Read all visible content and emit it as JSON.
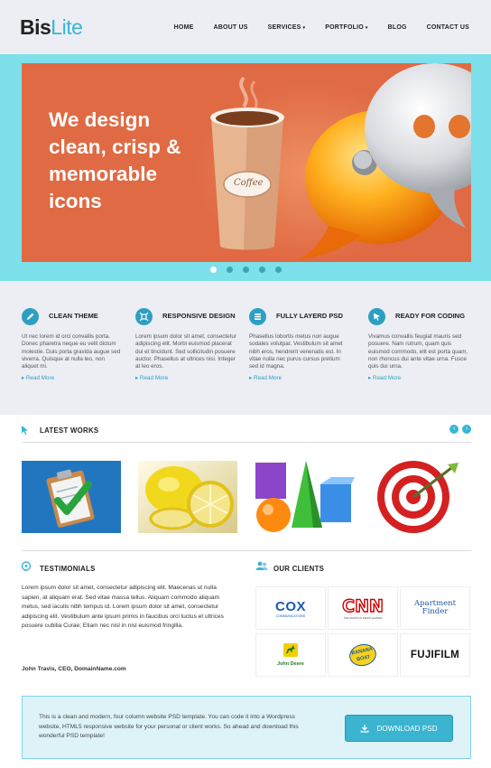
{
  "brand": {
    "name_bold": "Bis",
    "name_light": "Lite"
  },
  "nav": {
    "items": [
      "HOME",
      "ABOUT US",
      "SERVICES",
      "PORTFOLIO",
      "BLOG",
      "CONTACT US"
    ],
    "caret": "▾"
  },
  "hero": {
    "headline": "We design clean, crisp & memorable icons",
    "cup_label": "Coffee",
    "active_slide": 1,
    "slide_count": 5
  },
  "features": [
    {
      "title": "CLEAN THEME",
      "text": "Ut nec lorem id orci convallis porta. Donec pharetra neque eu velit dictum molestie. Duis porta gravida augue sed viverra. Quisque at nulla leo, non aliquet mi.",
      "more": "Read More",
      "icon": "pencil-icon"
    },
    {
      "title": "RESPONSIVE DESIGN",
      "text": "Lorem ipsum dolor sit amet, consectetur adipiscing elit. Morbi euismod placerat dui et tincidunt. Sed sollicitudin posuere auctor. Phasellus at ultrices nisi. Integer at leo eros.",
      "more": "Read More",
      "icon": "resize-icon"
    },
    {
      "title": "FULLY LAYERD PSD",
      "text": "Phasellus lobortis metus non augue sodales volutpat. Vestibulum sit amet nibh eros, hendrerit venenatis est. In vitae nulla nec purus cursus pretium sed id magna.",
      "more": "Read More",
      "icon": "layers-icon"
    },
    {
      "title": "READY FOR CODING",
      "text": "Vivamus convallis feugiat mauris sed posuere. Nam rutrum, quam quis euismod commodo, elit est porta quam, non rhoncus dui ante vitae urna. Fusce quis dui urna.",
      "more": "Read More",
      "icon": "cursor-icon"
    }
  ],
  "latest_works": {
    "title": "LATEST WORKS",
    "prev": "‹",
    "next": "›"
  },
  "testimonials": {
    "title": "TESTIMONIALS",
    "text": "Lorem ipsum dolor sit amet, consectetur adipiscing elit. Maecenas ut nulla sapien, at aliquam erat. Sed vitae massa tellus. Aliquam commodo aliquam metus, sed iaculis nibh tempus id. Lorem ipsum dolor sit amet, consectetur adipiscing elit. Vestibulum ante ipsum primis in faucibus orci luctus et ultrices posuere cubilia Curae; Etiam nec nisl in nisl euismod fringilla.",
    "author": "John Travis, CEO, DomainName.com"
  },
  "clients": {
    "title": "OUR CLIENTS",
    "logos": [
      {
        "name": "COX",
        "sub": "COMMUNICATIONS"
      },
      {
        "name": "CNN",
        "sub": "THE WORLD'S NEWS LEADER"
      },
      {
        "name": "Apartment",
        "sub": "Finder"
      },
      {
        "name": "John Deere"
      },
      {
        "name": "BANANA",
        "sub": "BOAT"
      },
      {
        "name": "FUJIFILM"
      }
    ]
  },
  "cta": {
    "text": "This is a clean and modern, four column website PSD template. You can code it into a Wordpress website, HTML5 responsive website for your personal or client works. So ahead and download this wonderful PSD template!",
    "button": "DOWNLOAD PSD"
  },
  "colors": {
    "accent": "#37b6d4",
    "hero_bg": "#7de0ea",
    "slide_bg": "#e06a43",
    "panel_bg": "#eceef4"
  }
}
